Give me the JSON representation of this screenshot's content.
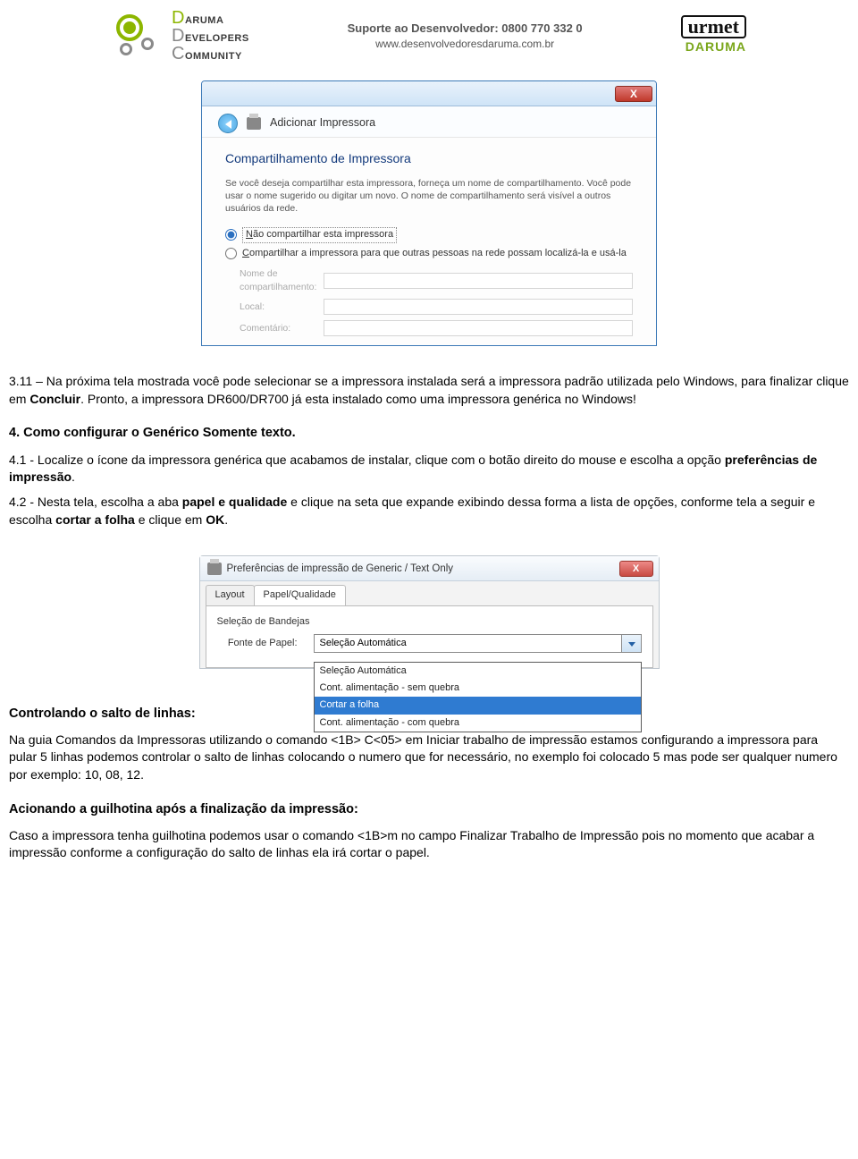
{
  "header": {
    "ddc_line1_letter": "D",
    "ddc_line1_rest": "ARUMA",
    "ddc_line2_letter": "D",
    "ddc_line2_rest": "EVELOPERS",
    "ddc_line3_letter": "C",
    "ddc_line3_rest": "OMMUNITY",
    "support_line1": "Suporte ao Desenvolvedor: 0800 770 332 0",
    "support_line2": "www.desenvolvedoresdaruma.com.br",
    "urmet": "urmet",
    "daruma": "DARUMA"
  },
  "wizard": {
    "close": "X",
    "nav_title": "Adicionar Impressora",
    "heading": "Compartilhamento de Impressora",
    "blurb": "Se você deseja compartilhar esta impressora, forneça um nome de compartilhamento. Você pode usar o nome sugerido ou digitar um novo. O nome de compartilhamento será visível a outros usuários da rede.",
    "radio1_pre": "N",
    "radio1_rest": "ão compartilhar esta impressora",
    "radio2_pre": "C",
    "radio2_rest": "ompartilhar a impressora para que outras pessoas na rede possam localizá-la e usá-la",
    "lbl_share": "Nome de compartilhamento:",
    "lbl_local": "Local:",
    "lbl_comment": "Comentário:"
  },
  "body": {
    "p311_a": "3.11 – Na próxima tela mostrada você pode selecionar se a impressora instalada será a impressora padrão utilizada pelo Windows, para finalizar clique em ",
    "p311_b": "Concluir",
    "p311_c": ". Pronto, a impressora DR600/DR700 já esta instalado como uma impressora genérica no Windows!",
    "h4": "4.     Como configurar o Genérico Somente texto.",
    "p41_a": "4.1 - Localize o ícone da impressora genérica que acabamos de instalar, clique com o botão direito do mouse e escolha a opção ",
    "p41_b": "preferências de impressão",
    "p41_c": ".",
    "p42_a": "4.2 - Nesta tela, escolha a aba ",
    "p42_b": "papel e qualidade",
    "p42_c": " e clique na seta que expande exibindo dessa forma a lista de opções, conforme tela a seguir e escolha ",
    "p42_d": "cortar a folha",
    "p42_e": " e clique em ",
    "p42_f": "OK",
    "p42_g": ".",
    "h_salto": "Controlando o salto de linhas:",
    "p_salto": "Na guia Comandos da Impressoras  utilizando o comando <1B> C<05> em Iniciar trabalho de impressão estamos configurando a impressora para pular 5 linhas podemos controlar o salto de linhas colocando o numero que for necessário, no exemplo foi colocado 5 mas pode ser qualquer numero por exemplo: 10, 08, 12.",
    "h_guil": "Acionando a guilhotina após a finalização da impressão:",
    "p_guil": "Caso a impressora tenha guilhotina podemos usar o comando <1B>m no campo Finalizar Trabalho de Impressão pois no momento que acabar a impressão conforme a configuração do salto de linhas ela irá cortar o papel."
  },
  "prefs": {
    "title": "Preferências de impressão de Generic / Text Only",
    "close": "X",
    "tab_layout": "Layout",
    "tab_paper": "Papel/Qualidade",
    "group": "Seleção de Bandejas",
    "lbl_source": "Fonte de Papel:",
    "combo_value": "Seleção Automática",
    "options": [
      "Seleção Automática",
      "Cont. alimentação - sem quebra",
      "Cortar a folha",
      "Cont. alimentação - com quebra"
    ],
    "selected_index": 2
  }
}
